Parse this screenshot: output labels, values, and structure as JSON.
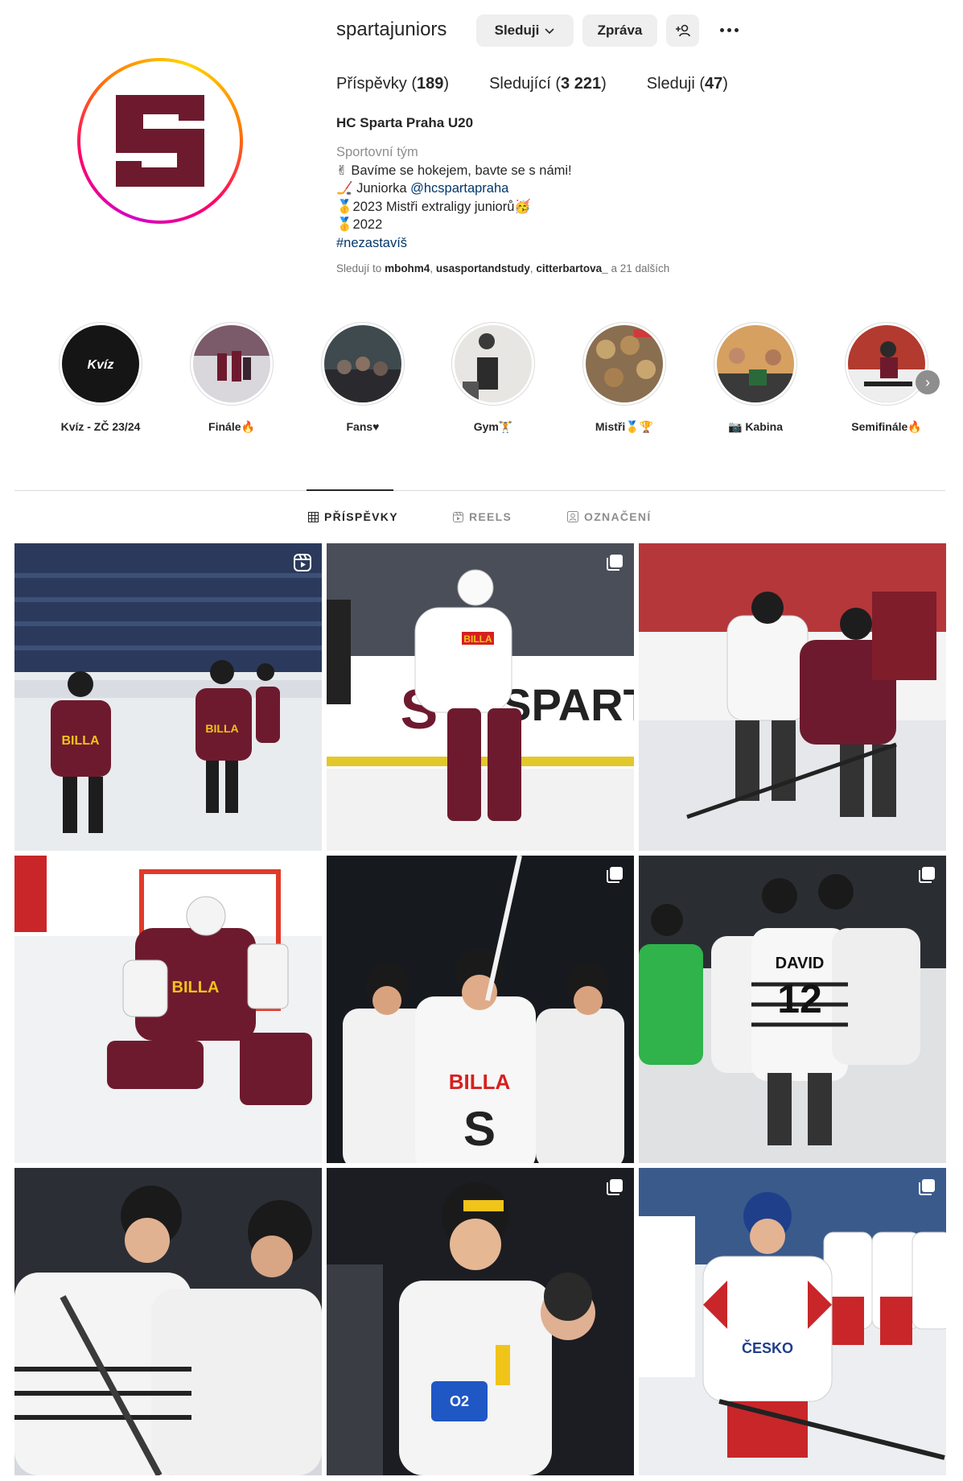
{
  "profile": {
    "username": "spartajuniors",
    "follow_label": "Sleduji",
    "message_label": "Zpráva",
    "stats": {
      "posts_label": "Příspěvky",
      "posts_count": "189",
      "followers_label": "Sledující",
      "followers_count": "3 221",
      "following_label": "Sleduji",
      "following_count": "47"
    },
    "full_name": "HC Sparta Praha U20",
    "category": "Sportovní tým",
    "bio": {
      "line1": "✌ Bavíme se hokejem, bavte se s námi!",
      "line2_prefix": "🏒 Juniorka ",
      "line2_mention": "@hcspartapraha",
      "line3": "🥇2023 Mistři extraligy juniorů🥳",
      "line4": "🥇2022",
      "hashtag": "#nezastavíš"
    },
    "followed_by": {
      "prefix": "Sledují to",
      "users": [
        "mbohm4",
        "usasportandstudy",
        "citterbartova_"
      ],
      "suffix": "a 21 dalších"
    }
  },
  "highlights": [
    {
      "label": "Kvíz - ZČ 23/24",
      "cover_text": "Kvíz"
    },
    {
      "label": "Finále🔥"
    },
    {
      "label": "Fans♥"
    },
    {
      "label": "Gym🏋"
    },
    {
      "label": "Mistři🥇🏆"
    },
    {
      "label": "📷 Kabina"
    },
    {
      "label": "Semifinále🔥"
    }
  ],
  "tabs": [
    {
      "label": "PŘÍSPĚVKY",
      "active": true
    },
    {
      "label": "REELS",
      "active": false
    },
    {
      "label": "OZNAČENÍ",
      "active": false
    }
  ],
  "posts": [
    {
      "kind": "reel"
    },
    {
      "kind": "carousel"
    },
    {
      "kind": "single"
    },
    {
      "kind": "single"
    },
    {
      "kind": "carousel"
    },
    {
      "kind": "carousel"
    },
    {
      "kind": "single"
    },
    {
      "kind": "carousel"
    },
    {
      "kind": "carousel"
    }
  ],
  "colors": {
    "sparta_burgundy": "#6e1a2e",
    "link": "#00376b",
    "muted": "#8e8e8e",
    "button_bg": "#efefef"
  }
}
